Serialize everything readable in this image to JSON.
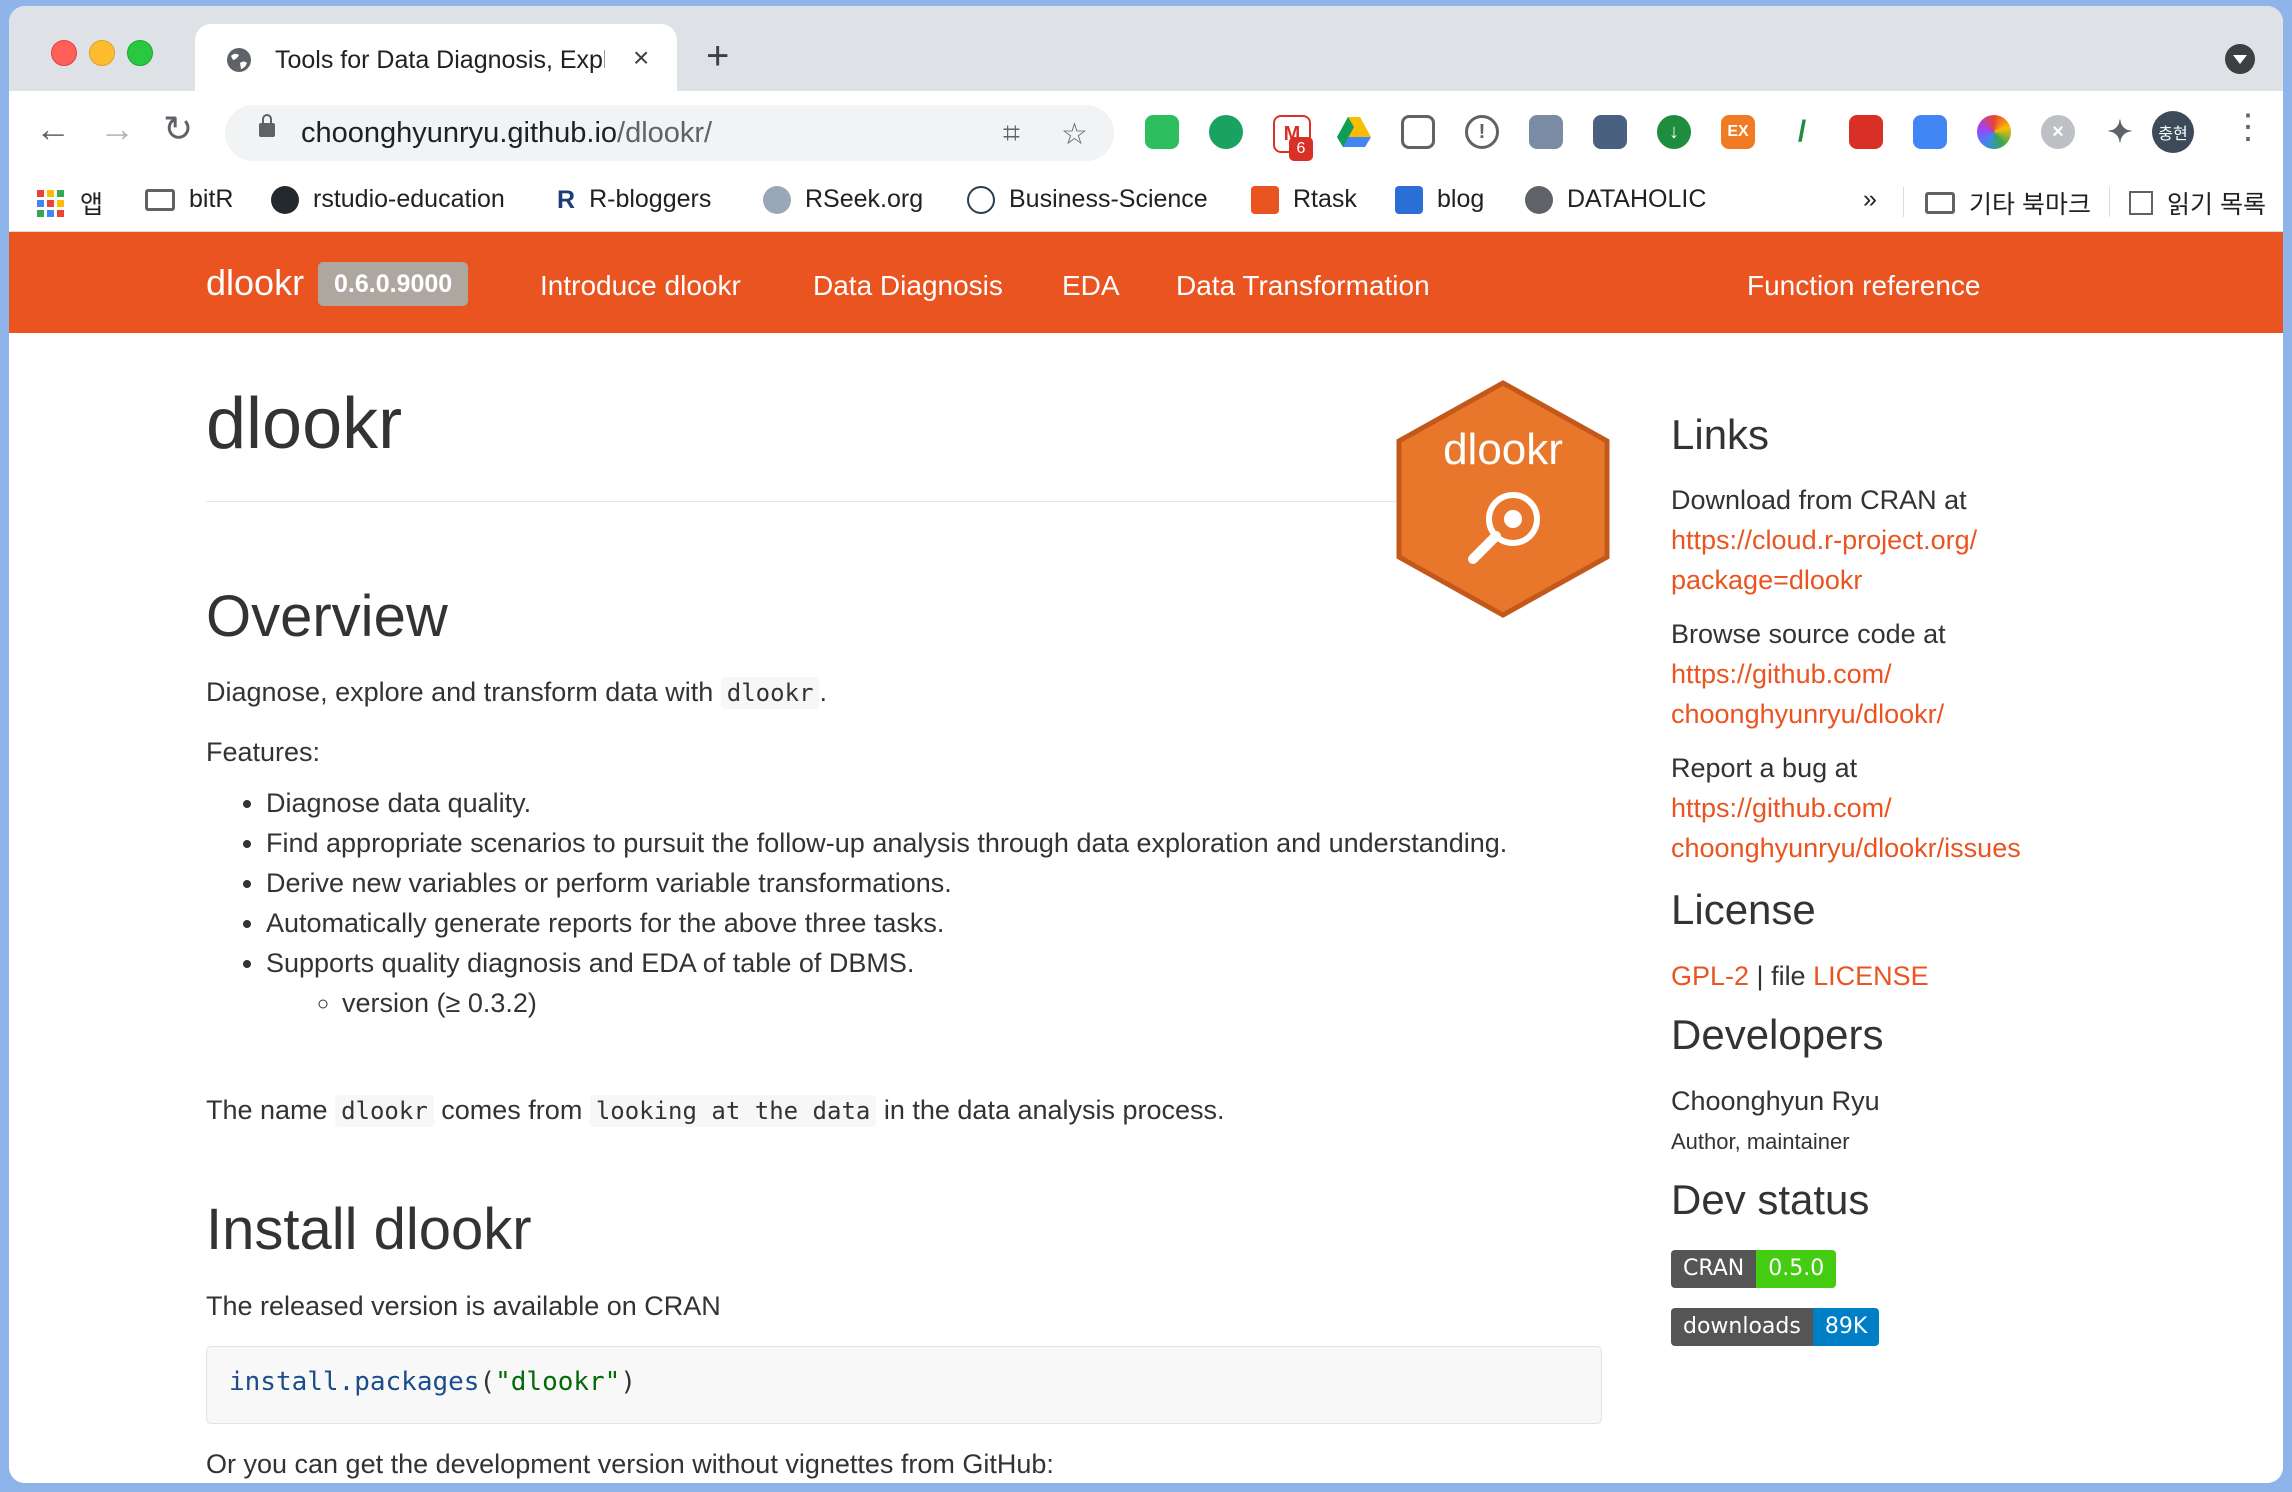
{
  "browser": {
    "tab_title": "Tools for Data Diagnosis, Explo",
    "new_tab": "+",
    "close": "×",
    "url_host": "choonghyunryu.github.io",
    "url_path": "/dlookr/",
    "avatar_text": "충현",
    "mail_badge": "6",
    "ext_label": "EX"
  },
  "bookmarks": {
    "apps": "앱",
    "items": [
      "bitR",
      "rstudio-education",
      "R-bloggers",
      "RSeek.org",
      "Business-Science",
      "Rtask",
      "blog",
      "DATAHOLIC"
    ],
    "overflow": "»",
    "other": "기타 북마크",
    "reading_list": "읽기 목록"
  },
  "site": {
    "brand": "dlookr",
    "version": "0.6.0.9000",
    "nav": [
      "Introduce dlookr",
      "Data Diagnosis",
      "EDA",
      "Data Transformation"
    ],
    "nav_right": "Function reference",
    "logo_text": "dlookr"
  },
  "main": {
    "title": "dlookr",
    "overview_heading": "Overview",
    "overview_text_pre": "Diagnose, explore and transform data with ",
    "overview_code": "dlookr",
    "overview_text_post": ".",
    "features_label": "Features:",
    "features": [
      "Diagnose data quality.",
      "Find appropriate scenarios to pursuit the follow-up analysis through data exploration and understanding.",
      "Derive new variables or perform variable transformations.",
      "Automatically generate reports for the above three tasks.",
      "Supports quality diagnosis and EDA of table of DBMS."
    ],
    "sub_feature": "version (≥ 0.3.2)",
    "name_pre": "The name ",
    "name_code1": "dlookr",
    "name_mid": " comes from ",
    "name_code2": "looking at the data",
    "name_post": " in the data analysis process.",
    "install_heading": "Install dlookr",
    "install_text": "The released version is available on CRAN",
    "code_fn": "install.packages",
    "code_open": "(",
    "code_arg": "\"dlookr\"",
    "code_close": ")",
    "dev_text": "Or you can get the development version without vignettes from GitHub:"
  },
  "sidebar": {
    "links_heading": "Links",
    "cran_label": "Download from CRAN at",
    "cran_link_1": "https://cloud.r-project.org/",
    "cran_link_2": "package=dlookr",
    "source_label": "Browse source code at",
    "source_link_1": "https://github.com/",
    "source_link_2": "choonghyunryu/dlookr/",
    "bug_label": "Report a bug at",
    "bug_link_1": "https://github.com/",
    "bug_link_2": "choonghyunryu/dlookr/issues",
    "license_heading": "License",
    "license_gpl": "GPL-2",
    "license_sep": " | file ",
    "license_file": "LICENSE",
    "developers_heading": "Developers",
    "developer_name": "Choonghyun Ryu",
    "developer_role": "Author, maintainer",
    "devstatus_heading": "Dev status",
    "badge_cran_label": "CRAN",
    "badge_cran_value": "0.5.0",
    "badge_dl_label": "downloads",
    "badge_dl_value": "89K"
  },
  "colors": {
    "brand_orange": "#e95420",
    "badge_green": "#4c1",
    "badge_blue": "#007ec6",
    "logo_orange": "#e8762b"
  }
}
